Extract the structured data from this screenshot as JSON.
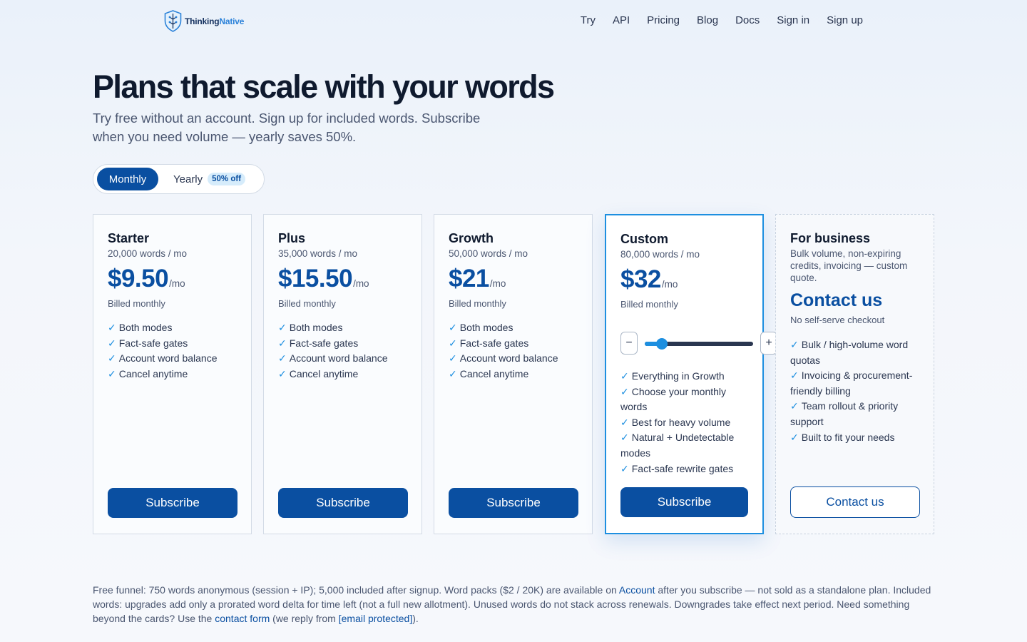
{
  "brand": {
    "name_part1": "Thinking",
    "name_part2": "Native"
  },
  "nav": {
    "items": [
      "Try",
      "API",
      "Pricing",
      "Blog",
      "Docs",
      "Sign in",
      "Sign up"
    ]
  },
  "hero": {
    "title": "Plans that scale with your words",
    "subtitle": "Try free without an account. Sign up for included words. Subscribe when you need volume — yearly saves 50%."
  },
  "billing_toggle": {
    "monthly": "Monthly",
    "yearly": "Yearly",
    "yearly_badge": "50% off",
    "selected": "Monthly"
  },
  "plans": [
    {
      "name": "Starter",
      "words": "20,000 words / mo",
      "price": "$9.50",
      "per": "/mo",
      "billed": "Billed monthly",
      "features": [
        "Both modes",
        "Fact-safe gates",
        "Account word balance",
        "Cancel anytime"
      ],
      "cta": "Subscribe"
    },
    {
      "name": "Plus",
      "words": "35,000 words / mo",
      "price": "$15.50",
      "per": "/mo",
      "billed": "Billed monthly",
      "features": [
        "Both modes",
        "Fact-safe gates",
        "Account word balance",
        "Cancel anytime"
      ],
      "cta": "Subscribe"
    },
    {
      "name": "Growth",
      "words": "50,000 words / mo",
      "price": "$21",
      "per": "/mo",
      "billed": "Billed monthly",
      "features": [
        "Both modes",
        "Fact-safe gates",
        "Account word balance",
        "Cancel anytime"
      ],
      "cta": "Subscribe"
    },
    {
      "name": "Custom",
      "words": "80,000 words / mo",
      "price": "$32",
      "per": "/mo",
      "billed": "Billed monthly",
      "slider_fraction": 0.12,
      "features": [
        "Everything in Growth",
        "Choose your monthly words",
        "Best for heavy volume",
        "Natural + Undetectable modes",
        "Fact-safe rewrite gates"
      ],
      "cta": "Subscribe"
    }
  ],
  "business": {
    "name": "For business",
    "description": "Bulk volume, non-expiring credits, invoicing — custom quote.",
    "price_label": "Contact us",
    "note": "No self-serve checkout",
    "features": [
      "Bulk / high-volume word quotas",
      "Invoicing & procurement-friendly billing",
      "Team rollout & priority support",
      "Built to fit your needs"
    ],
    "cta": "Contact us"
  },
  "footnote": {
    "part1": "Free funnel: 750 words anonymous (session + IP); 5,000 included after signup. Word packs ($2 / 20K) are available on ",
    "account_link": "Account",
    "part2": " after you subscribe — not sold as a standalone plan. Included words: upgrades add only a prorated word delta for time left (not a full new allotment). Unused words do not stack across renewals. Downgrades take effect next period. Need something beyond the cards? Use the ",
    "contact_link": "contact form",
    "part3": " (we reply from ",
    "email_link": "[email protected]",
    "part4": ")."
  },
  "colors": {
    "primary": "#0a4fa1",
    "accent": "#1d8fe0",
    "text": "#0f1a2e",
    "muted": "#4a5670"
  },
  "icons": {
    "logo": "shield-circuit-icon",
    "check": "check-icon"
  }
}
